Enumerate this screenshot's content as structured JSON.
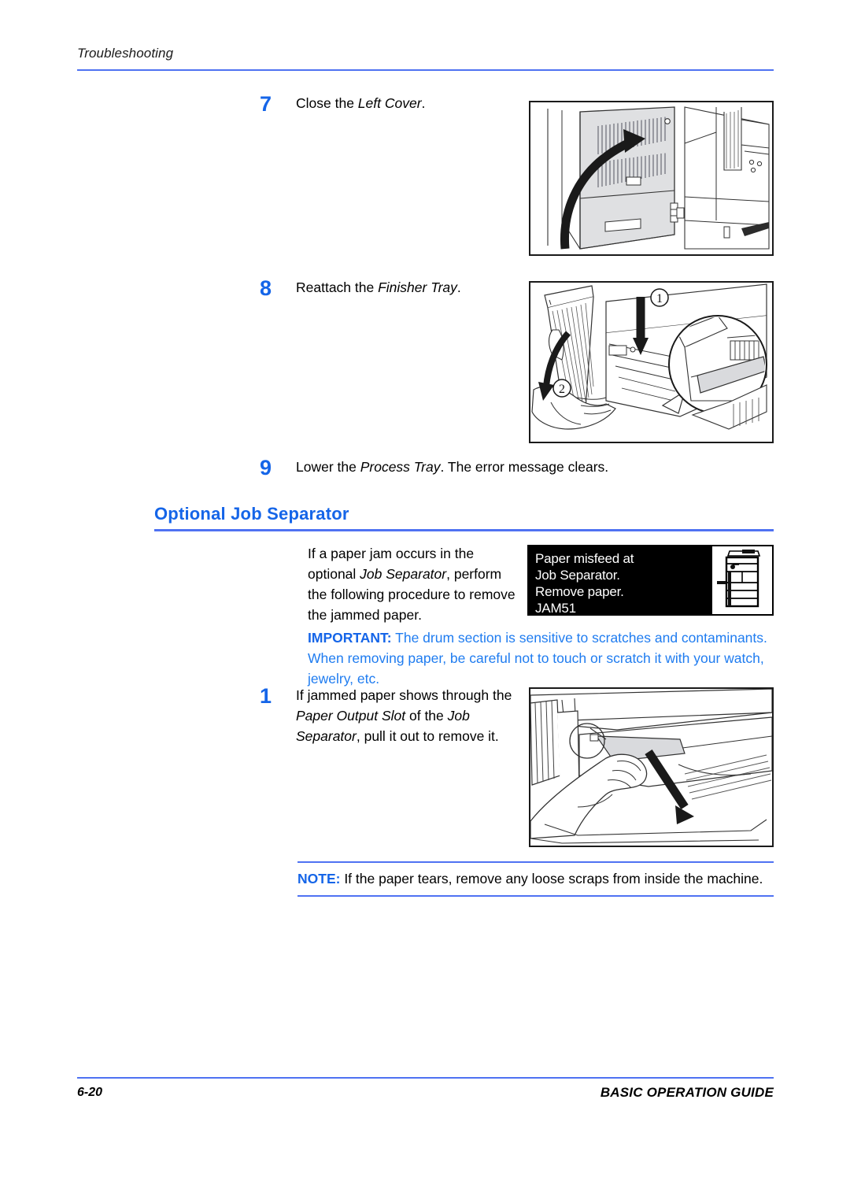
{
  "header": {
    "running_head": "Troubleshooting"
  },
  "steps": [
    {
      "number": "7",
      "text_parts": [
        {
          "text": "Close the ",
          "style": "normal"
        },
        {
          "text": "Left Cover",
          "style": "italic"
        },
        {
          "text": ".",
          "style": "normal"
        }
      ],
      "plain": "Close the Left Cover."
    },
    {
      "number": "8",
      "text_parts": [
        {
          "text": "Reattach the ",
          "style": "normal"
        },
        {
          "text": "Finisher Tray",
          "style": "italic"
        },
        {
          "text": ".",
          "style": "normal"
        }
      ],
      "plain": "Reattach the Finisher Tray."
    },
    {
      "number": "9",
      "text_parts": [
        {
          "text": "Lower the ",
          "style": "normal"
        },
        {
          "text": "Process Tray",
          "style": "italic"
        },
        {
          "text": ". The error message clears.",
          "style": "normal"
        }
      ],
      "plain": "Lower the Process Tray. The error message clears."
    }
  ],
  "section": {
    "heading": "Optional Job Separator",
    "intro": {
      "line1": "If a paper jam occurs in the",
      "line2_prefix": "optional ",
      "line2_italic": "Job Separator",
      "line2_suffix": ", perform",
      "line3": "the following procedure to remove",
      "line4": "the jammed paper."
    }
  },
  "lcd": {
    "line1": "Paper misfeed at",
    "line2": "Job Separator.",
    "line3": "Remove paper.",
    "line4": "JAM51",
    "icon_name": "copier-machine-icon"
  },
  "important": {
    "label": "IMPORTANT:",
    "body": " The drum section is sensitive to scratches and contaminants. When removing paper, be careful not to touch or scratch it with your watch, jewelry, etc."
  },
  "jam_step": {
    "number": "1",
    "line1": "If jammed paper shows through",
    "line2_prefix": "the ",
    "line2_italic": "Paper Output Slot",
    "line2_mid": " of the ",
    "line2_italic2": "Job",
    "line3_italic": "Separator",
    "line3_suffix": ", pull it out to remove it."
  },
  "note": {
    "label": "NOTE:",
    "body": " If the paper tears, remove any loose scraps from inside the machine."
  },
  "footer": {
    "page_number": "6-20",
    "guide_title": "BASIC OPERATION GUIDE"
  },
  "illustrations": [
    {
      "name": "left-cover-closing-illustration",
      "callouts": [],
      "caption": "Copier with left cover and upward curved arrow"
    },
    {
      "name": "finisher-tray-reattach-illustration",
      "callouts": [
        "1",
        "2"
      ],
      "caption": "Hands reattaching finisher tray with inset detail circle"
    },
    {
      "name": "paper-output-slot-pull-illustration",
      "callouts": [],
      "caption": "Hand pulling jammed paper out of paper output slot"
    }
  ],
  "colors": {
    "accent_blue": "#1565e8",
    "rule_blue": "#4f72f2",
    "important_blue": "#1f7cf0",
    "ink_black": "#000000",
    "shade_gray": "#d9dadd"
  }
}
